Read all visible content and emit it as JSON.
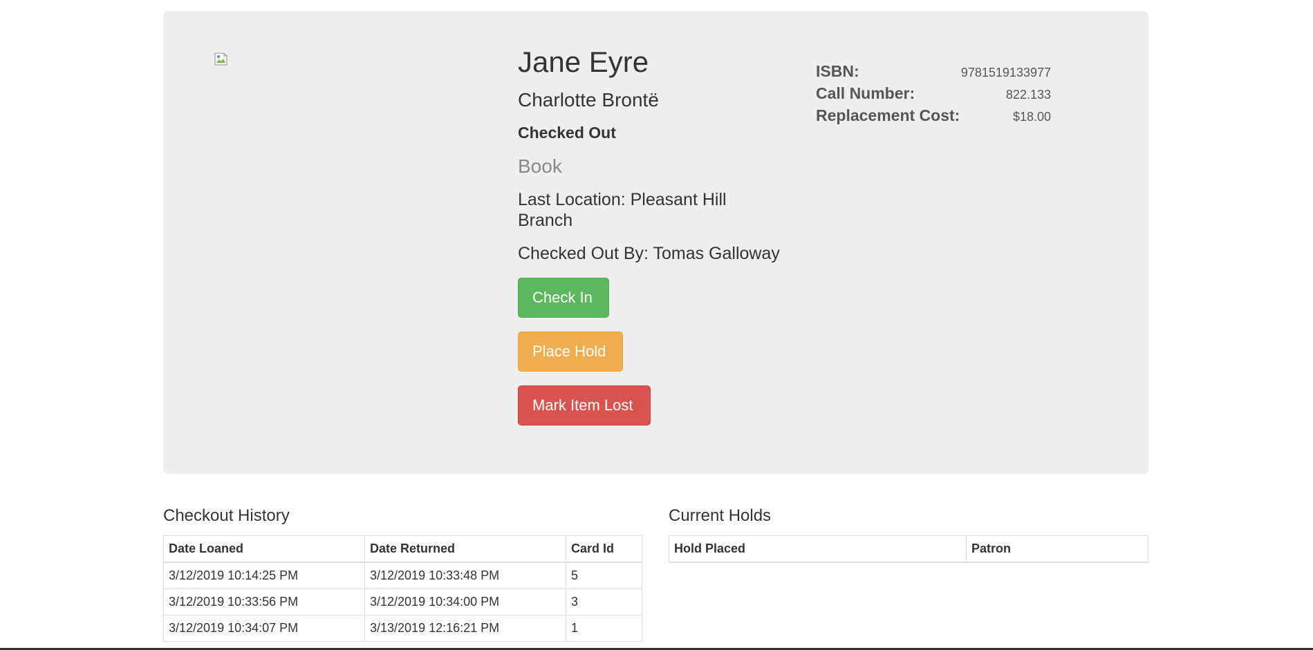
{
  "item": {
    "title": "Jane Eyre",
    "author": "Charlotte Brontë",
    "status": "Checked Out",
    "type": "Book",
    "last_location": "Last Location: Pleasant Hill Branch",
    "checked_out_by": "Checked Out By: Tomas Galloway"
  },
  "actions": {
    "check_in": "Check In",
    "place_hold": "Place Hold",
    "mark_lost": "Mark Item Lost"
  },
  "details": {
    "isbn_label": "ISBN:",
    "isbn_value": "9781519133977",
    "call_label": "Call Number:",
    "call_value": "822.133",
    "cost_label": "Replacement Cost:",
    "cost_value": "$18.00"
  },
  "checkout_history": {
    "title": "Checkout History",
    "columns": [
      "Date Loaned",
      "Date Returned",
      "Card Id"
    ],
    "rows": [
      [
        "3/12/2019 10:14:25 PM",
        "3/12/2019 10:33:48 PM",
        "5"
      ],
      [
        "3/12/2019 10:33:56 PM",
        "3/12/2019 10:34:00 PM",
        "3"
      ],
      [
        "3/12/2019 10:34:07 PM",
        "3/13/2019 12:16:21 PM",
        "1"
      ]
    ]
  },
  "current_holds": {
    "title": "Current Holds",
    "columns": [
      "Hold Placed",
      "Patron"
    ]
  },
  "colors": {
    "panel_bg": "#eeeeee",
    "success": "#5cb85c",
    "warning": "#f0ad4e",
    "danger": "#d9534f"
  }
}
